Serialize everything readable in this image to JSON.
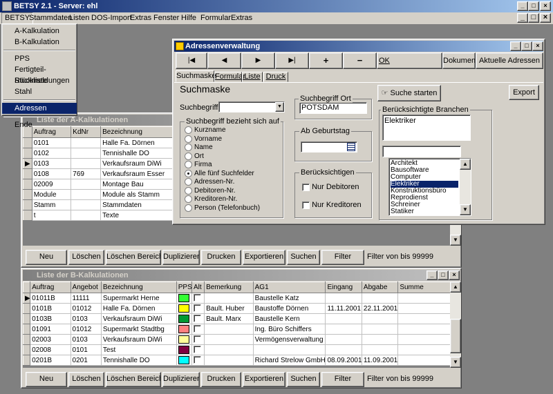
{
  "app": {
    "title": "BETSY 2.1 - Server: ehl"
  },
  "menubar": [
    "BETSY",
    "Stammdaten",
    "Listen",
    "DOS-Import",
    "Extras",
    "Fenster",
    "Hilfe",
    "Formular",
    "Extras"
  ],
  "betsy_menu": {
    "items": [
      "A-Kalkulation",
      "B-Kalkulation",
      "PPS",
      "Fertigteil-Stückliste",
      "Rückmeldungen",
      "Stahl",
      "Adressen",
      "Ende"
    ],
    "selected": "Adressen"
  },
  "list_a": {
    "title": "Liste der A-Kalkulationen",
    "columns": [
      "Auftrag",
      "KdNr",
      "Bezeichnung"
    ],
    "rows": [
      [
        "0101",
        "",
        "Halle Fa. Dörnen"
      ],
      [
        "0102",
        "",
        "Tennishalle DO"
      ],
      [
        "0103",
        "",
        "Verkaufsraum DiWi"
      ],
      [
        "0108",
        "769",
        "Verkaufsraum Esser"
      ],
      [
        "02009",
        "",
        "Montage Bau"
      ],
      [
        "Module",
        "",
        "Module als Stamm"
      ],
      [
        "Stamm",
        "",
        "Stammdaten"
      ],
      [
        "t",
        "",
        "Texte"
      ]
    ],
    "current_row": 2,
    "buttons": [
      "Neu",
      "Löschen",
      "Löschen Bereich",
      "Duplizieren",
      "Drucken",
      "Exportieren",
      "Suchen",
      "Filter"
    ],
    "filter_text": "Filter von  bis 99999"
  },
  "list_b": {
    "title": "Liste der B-Kalkulationen",
    "columns": [
      "Auftrag",
      "Angebot",
      "Bezeichnung",
      "PPS",
      "Alt",
      "Bemerkung",
      "AG1",
      "Eingang",
      "Abgabe",
      "Summe"
    ],
    "rows": [
      [
        "01011B",
        "11111",
        "Supermarkt Herne",
        "#33ff33",
        "",
        "Baustelle Katz",
        "",
        "",
        ""
      ],
      [
        "0101B",
        "01012",
        "Halle Fa. Dörnen",
        "#ffff00",
        "Bault. Huber",
        "Baustoffe Dörnen",
        "11.11.2001",
        "22.11.2001",
        ""
      ],
      [
        "0103B",
        "0103",
        "Verkaufsraum DiWi",
        "#009933",
        "Bault. Marx",
        "Baustelle Kern",
        "",
        "",
        ""
      ],
      [
        "01091",
        "01012",
        "Supermarkt Stadtbg",
        "#ff8080",
        "",
        "Ing. Büro Schiffers",
        "",
        "",
        ""
      ],
      [
        "02003",
        "0103",
        "Verkaufsraum DiWi",
        "#ffff99",
        "",
        "Vermögensverwaltung Bra",
        "",
        "",
        ""
      ],
      [
        "02008",
        "0101",
        "Test",
        "#800040",
        "",
        "",
        "",
        "",
        ""
      ],
      [
        "0201B",
        "0201",
        "Tennishalle DO",
        "#00ffff",
        "",
        "Richard Strelow GmbH",
        "08.09.2001",
        "11.09.2001",
        ""
      ]
    ],
    "buttons": [
      "Neu",
      "Löschen",
      "Löschen Bereich",
      "Duplizieren",
      "Drucken",
      "Exportieren",
      "Suchen",
      "Filter"
    ],
    "filter_text": "Filter von  bis 99999"
  },
  "dialog": {
    "title": "Adressenverwaltung",
    "nav": [
      "|◀",
      "◀",
      "▶",
      "▶|",
      "+",
      "−"
    ],
    "ok": "OK",
    "dokumente": "Dokumente",
    "aktuelle": "Aktuelle Adressen",
    "tabs": [
      "Suchmaske",
      "Formular",
      "Liste",
      "Druck"
    ],
    "heading": "Suchmaske",
    "suchbegriff_label": "Suchbegriff",
    "suchbegriff_value": "",
    "bezieht_label": "Suchbegriff bezieht sich auf",
    "radios": [
      "Kurzname",
      "Vorname",
      "Name",
      "Ort",
      "Firma",
      "Alle fünf Suchfelder",
      "Adressen-Nr.",
      "Debitoren-Nr.",
      "Kreditoren-Nr.",
      "Person (Telefonbuch)"
    ],
    "radio_selected": 5,
    "ort_label": "Suchbegriff Ort",
    "ort_value": "POTSDAM",
    "geburtstag_label": "Ab Geburtstag",
    "geburtstag_value": "",
    "beruecksichtigen_label": "Berücksichtigen",
    "nur_debitoren": "Nur Debitoren",
    "nur_kreditoren": "Nur Kreditoren",
    "suche_starten": "Suche starten",
    "export": "Export",
    "branchen_label": "Berücksichtigte Branchen",
    "branchen_selected": [
      "Elektriker"
    ],
    "branchen_filter": "",
    "branchen_list": [
      "Architekt",
      "Bausoftware",
      "Computer",
      "Elektriker",
      "Konstruktionsbüro",
      "Reprodienst",
      "Schreiner",
      "Statiker"
    ],
    "branchen_highlight": "Elektriker"
  }
}
